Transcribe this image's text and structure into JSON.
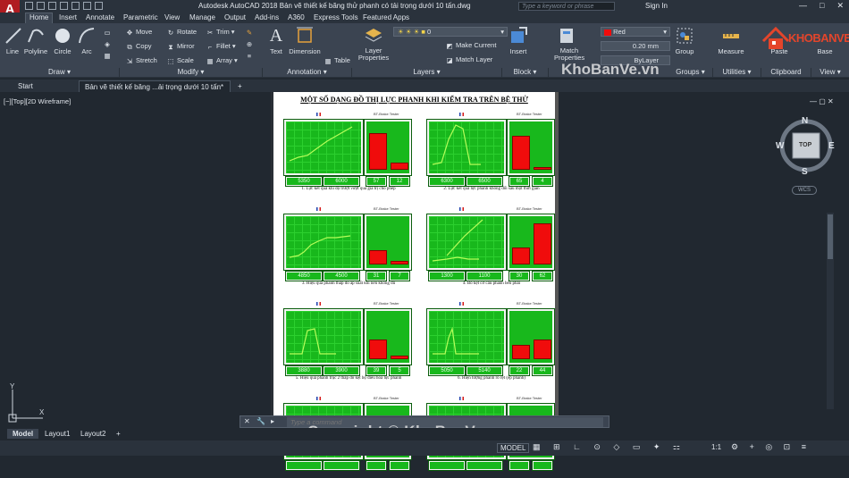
{
  "app": {
    "logo": "A",
    "title": "Autodesk AutoCAD 2018    Bản vẽ thiết kế băng thử phanh có tải trọng dưới 10 tấn.dwg",
    "search_placeholder": "Type a keyword or phrase",
    "signin": "Sign In",
    "win_min": "—",
    "win_max": "□",
    "win_close": "✕"
  },
  "tabs": [
    "Home",
    "Insert",
    "Annotate",
    "Parametric",
    "View",
    "Manage",
    "Output",
    "Add-ins",
    "A360",
    "Express Tools",
    "Featured Apps"
  ],
  "ribbon": {
    "draw": {
      "line": "Line",
      "polyline": "Polyline",
      "circle": "Circle",
      "arc": "Arc",
      "panel": "Draw ▾"
    },
    "modify": {
      "move": "Move",
      "rotate": "Rotate",
      "trim": "Trim ▾",
      "copy": "Copy",
      "mirror": "Mirror",
      "fillet": "Fillet ▾",
      "stretch": "Stretch",
      "scale": "Scale",
      "array": "Array ▾",
      "panel": "Modify ▾"
    },
    "annotation": {
      "text": "Text",
      "dimension": "Dimension",
      "table": "Table",
      "panel": "Annotation ▾"
    },
    "layers": {
      "layer_properties": "Layer Properties",
      "layer_current": "0",
      "make_current": "Make Current",
      "match_layer": "Match Layer",
      "panel": "Layers ▾"
    },
    "block": {
      "insert": "Insert",
      "panel": "Block ▾"
    },
    "properties": {
      "match": "Match Properties",
      "color": "Red",
      "lineweight": "0.20 mm",
      "linetype": "ByLayer",
      "panel": "Properties ▾"
    },
    "groups": {
      "group": "Group",
      "panel": "Groups ▾"
    },
    "utilities": {
      "measure": "Measure",
      "panel": "Utilities ▾"
    },
    "clipboard": {
      "paste": "Paste",
      "panel": "Clipboard"
    },
    "view": {
      "base": "Base",
      "panel": "View ▾"
    }
  },
  "doc_tabs": {
    "start": "Start",
    "drawing": "Bản vẽ thiết kế băng ...ải trọng dưới 10 tấn*",
    "add": "+"
  },
  "viewport_label": "[−][Top][2D Wireframe]",
  "sheet": {
    "title": "MỘT SỐ DẠNG ĐỒ THỊ LỰC PHANH KHI KIỂM TRA TRÊN BỆ THỬ"
  },
  "charts": [
    {
      "caption": "1. Lực kết quả khi độ trượt vượt quá giá trị cho phép",
      "values": [
        "5350",
        "6000",
        "57",
        "12"
      ],
      "bars": [
        0.75,
        0.15
      ]
    },
    {
      "caption": "2. Lực kết quả lực phanh không đổi sau một thời gian",
      "values": [
        "6300",
        "6500",
        "65",
        "4"
      ],
      "bars": [
        0.7,
        0.05
      ]
    },
    {
      "caption": "3. Hiệu quả phanh thấp do áp suất khí nén không đủ",
      "values": [
        "4850",
        "4500",
        "31",
        "7"
      ],
      "bars": [
        0.3,
        0.08
      ]
    },
    {
      "caption": "4. Bó kẹt cơ cấu phanh bên phải",
      "values": [
        "1300",
        "1100",
        "30",
        "62"
      ],
      "bars": [
        0.35,
        0.85
      ]
    },
    {
      "caption": "5. Hiệu quả phanh trục 2 thấp do kẹt bộ điều hoà lực phanh",
      "values": [
        "3880",
        "3900",
        "39",
        "5"
      ],
      "bars": [
        0.4,
        0.08
      ]
    },
    {
      "caption": "6. Hiện tượng phanh rõ rệt (ép phanh)",
      "values": [
        "5050",
        "5140",
        "22",
        "44"
      ],
      "bars": [
        0.3,
        0.4
      ]
    },
    {
      "caption": "",
      "values": [
        "",
        "",
        "",
        ""
      ],
      "bars": [
        0.5,
        0.2
      ]
    },
    {
      "caption": "",
      "values": [
        "",
        "",
        "",
        ""
      ],
      "bars": [
        0.3,
        0.25
      ]
    }
  ],
  "chart_header": "BT-Brake Tester",
  "compass": {
    "n": "N",
    "s": "S",
    "e": "E",
    "w": "W",
    "top": "TOP",
    "wcs": "WCS"
  },
  "command": {
    "placeholder": "Type a command"
  },
  "layout_tabs": [
    "Model",
    "Layout1",
    "Layout2",
    "+"
  ],
  "status": {
    "model": "MODEL",
    "scale": "1:1"
  },
  "watermark": "Copyright © KhoBanVe.vn",
  "watermark2": "KhoBanVe.vn",
  "brand": "KHOBANVE",
  "colors": {
    "accent": "#b01c21",
    "red": "#f00c0c",
    "green": "#18b81c",
    "brand": "#e4452b"
  }
}
